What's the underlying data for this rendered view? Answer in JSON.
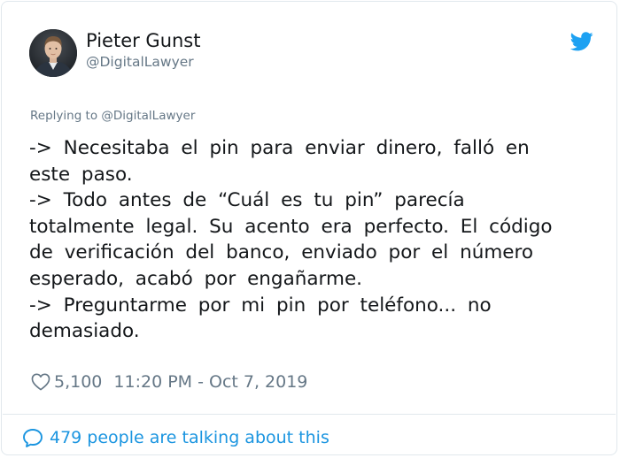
{
  "user": {
    "display_name": "Pieter Gunst",
    "handle": "@DigitalLawyer"
  },
  "replying_to": "Replying to @DigitalLawyer",
  "tweet": {
    "lines": [
      "-> Necesitaba el pin para enviar dinero, falló en",
      "este paso.",
      "-> Todo antes de “Cuál es tu pin” parecía",
      "totalmente legal. Su acento era perfecto. El código",
      "de verificación del banco, enviado por el número",
      "esperado, acabó por engañarme.",
      "-> Preguntarme por mi pin por teléfono... no",
      "demasiado."
    ]
  },
  "stats": {
    "likes": "5,100",
    "timestamp": "11:20 PM - Oct 7, 2019"
  },
  "footer": {
    "conversation_label": "479 people are talking about this"
  },
  "colors": {
    "brand": "#1da1f2",
    "link": "#1b95e0",
    "secondary_text": "#657786",
    "primary_text": "#14171a",
    "border": "#e1e8ed"
  },
  "icons": [
    "avatar",
    "twitter-bird-icon",
    "heart-icon",
    "comment-bubble-icon"
  ]
}
